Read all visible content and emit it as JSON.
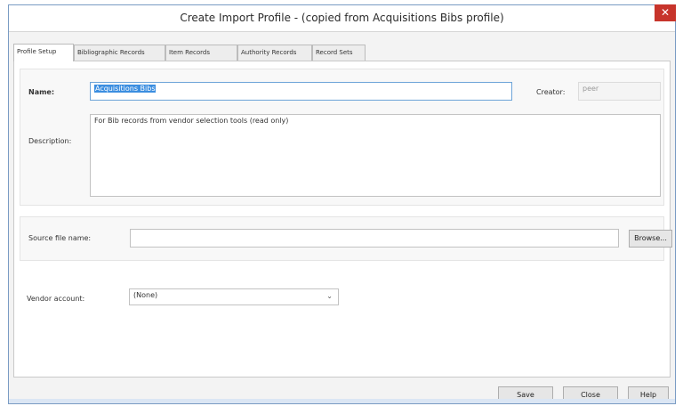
{
  "window": {
    "title": "Create Import Profile - (copied from Acquisitions Bibs profile)",
    "close_glyph": "✕"
  },
  "tabs": [
    {
      "label": "Profile Setup",
      "active": true
    },
    {
      "label": "Bibliographic Records",
      "active": false
    },
    {
      "label": "Item Records",
      "active": false
    },
    {
      "label": "Authority Records",
      "active": false
    },
    {
      "label": "Record Sets",
      "active": false
    }
  ],
  "profile": {
    "name_label": "Name:",
    "name_value": "Acquisitions Bibs",
    "creator_label": "Creator:",
    "creator_value": "peer",
    "description_label": "Description:",
    "description_value": "For Bib records from vendor selection tools (read only)"
  },
  "source": {
    "label": "Source file name:",
    "value": "",
    "browse_label": "Browse..."
  },
  "vendor": {
    "label": "Vendor account:",
    "selected": "(None)"
  },
  "buttons": {
    "save": "Save",
    "close": "Close",
    "help": "Help"
  }
}
